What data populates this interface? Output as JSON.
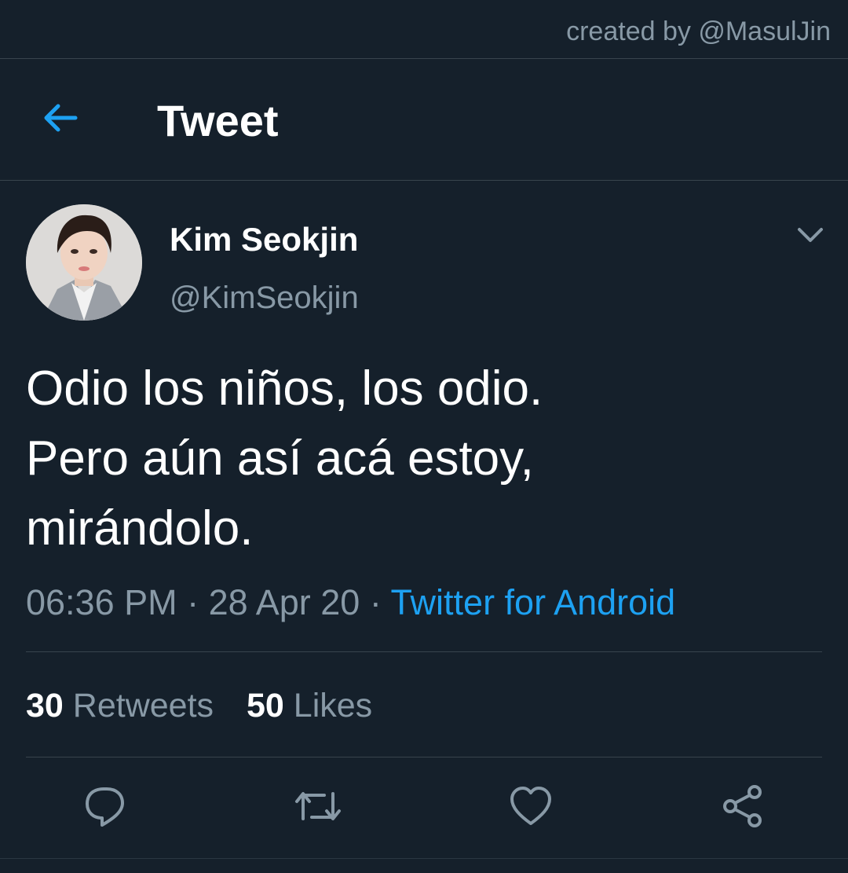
{
  "watermark": {
    "text": "created by @MasulJin"
  },
  "header": {
    "back_icon": "arrow-left-icon",
    "title": "Tweet"
  },
  "tweet": {
    "author": {
      "display_name": "Kim Seokjin",
      "handle": "@KimSeokjin",
      "avatar": "profile-photo"
    },
    "menu_icon": "chevron-down-icon",
    "text_lines": [
      "Odio los niños, los odio.",
      "Pero aún así acá estoy,",
      "mirándolo."
    ],
    "time": "06:36 PM",
    "date": "28 Apr 20",
    "separator": "·",
    "source": "Twitter for Android"
  },
  "stats": {
    "retweets_count": "30",
    "retweets_label": "Retweets",
    "likes_count": "50",
    "likes_label": "Likes"
  },
  "actions": {
    "reply_icon": "reply-icon",
    "retweet_icon": "retweet-icon",
    "like_icon": "heart-icon",
    "share_icon": "share-icon"
  },
  "colors": {
    "background": "#15202b",
    "accent": "#1da1f2",
    "muted_text": "#8899a6",
    "divider": "#38444d",
    "text": "#ffffff"
  }
}
